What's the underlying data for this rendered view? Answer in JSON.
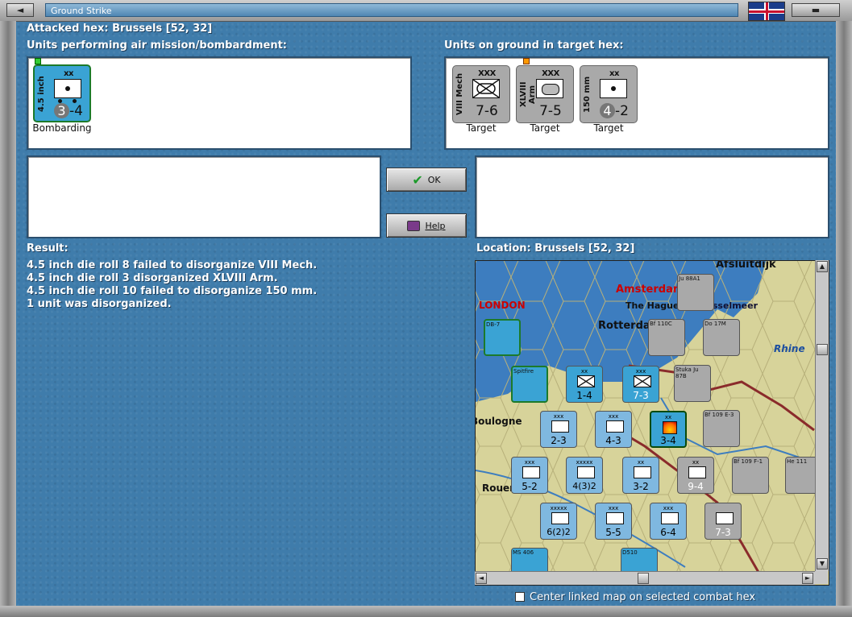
{
  "window": {
    "title": "Ground Strike",
    "close_glyph": "◄"
  },
  "attacked_hex": "Attacked hex: Brussels  [52, 32]",
  "air_units_label": "Units performing air mission/bombardment:",
  "ground_units_label": "Units on ground in target hex:",
  "air_units": [
    {
      "side": "4.5 inch",
      "size": "xx",
      "str_pre": "3",
      "str_post": "-4",
      "caption": "Bombarding"
    }
  ],
  "ground_units": [
    {
      "side": "VIII Mech",
      "size": "XXX",
      "str": "7-6",
      "caption": "Target"
    },
    {
      "side": "XLVIII Arm",
      "size": "XXX",
      "str": "7-5",
      "caption": "Target"
    },
    {
      "side": "150 mm",
      "size": "xx",
      "str_pre": "4",
      "str_post": "-2",
      "caption": "Target"
    }
  ],
  "buttons": {
    "ok": "OK",
    "help": "Help"
  },
  "result_label": "Result:",
  "results": [
    "4.5 inch die roll 8 failed to disorganize VIII Mech.",
    "4.5 inch die roll 3 disorganized XLVIII Arm.",
    "4.5 inch die roll 10 failed to disorganize 150 mm.",
    "1 unit was disorganized."
  ],
  "location_label": "Location:  Brussels  [52, 32]",
  "map": {
    "place_names": [
      "Afsluitdijk",
      "Amsterdam",
      "The Hague",
      "Ijsselmeer",
      "Rotterdam",
      "Rhine",
      "LONDON",
      "Boulogne",
      "Rouen"
    ],
    "counters": [
      {
        "top": "xx",
        "val": "1-4"
      },
      {
        "top": "xxx",
        "val": "7-3"
      },
      {
        "top": "xxx",
        "val": "2-3"
      },
      {
        "top": "xxx",
        "val": "4-3"
      },
      {
        "top": "xx",
        "val": "3-4"
      },
      {
        "top": "xxx",
        "val": "5-2"
      },
      {
        "top": "xxxxx",
        "val": "4(3)2"
      },
      {
        "top": "xx",
        "val": "3-2"
      },
      {
        "top": "xx",
        "val": "9-4"
      },
      {
        "top": "xxxxx",
        "val": "6(2)2"
      },
      {
        "top": "xxx",
        "val": "5-5"
      },
      {
        "top": "xxx",
        "val": "6-4"
      },
      {
        "top": "",
        "val": "7-3"
      }
    ],
    "aircraft": [
      "Spitfire",
      "Bf 110C",
      "Do 17M",
      "Ju 88A1",
      "Stuka Ju 87B",
      "Bf 109 E-3",
      "Bf 109 F-1",
      "He 111",
      "MS 406",
      "D510",
      "DB-7"
    ]
  },
  "center_map_label": "Center linked map on selected combat hex",
  "colors": {
    "background": "#3f7cab",
    "blue_counter": "#3aa3d4",
    "grey_counter": "#a9a9a9",
    "ok_check": "#1c9a2a"
  }
}
